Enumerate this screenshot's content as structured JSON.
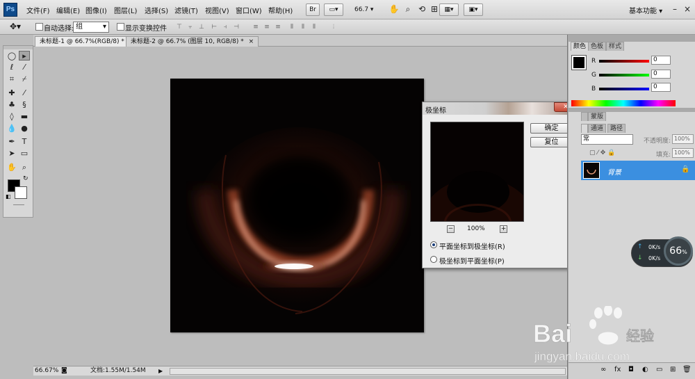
{
  "menubar": {
    "logo": "Ps",
    "menus": [
      "文件(F)",
      "编辑(E)",
      "图像(I)",
      "图层(L)",
      "选择(S)",
      "滤镜(T)",
      "视图(V)",
      "窗口(W)",
      "帮助(H)"
    ],
    "br_button": "Br",
    "zoom_value": "66.7",
    "workspace": "基本功能"
  },
  "options": {
    "auto_select_label": "自动选择:",
    "auto_select_value": "组",
    "show_transform_label": "显示变换控件"
  },
  "tabs": [
    {
      "label": "未标题-1 @ 66.7%(RGB/8) *",
      "close": "×"
    },
    {
      "label": "未标题-2 @ 66.7% (图层 10, RGB/8) *",
      "close": "×"
    }
  ],
  "status": {
    "zoom": "66.67%",
    "doc_info": "文档:1.55M/1.54M"
  },
  "dialog": {
    "title": "极坐标",
    "ok": "确定",
    "reset": "复位",
    "zoom_percent": "100%",
    "zoom_minus": "−",
    "zoom_plus": "+",
    "option1": "平面坐标到极坐标(R)",
    "option2": "极坐标到平面坐标(P)",
    "selected_option": 1
  },
  "color_panel": {
    "tabs": [
      "颜色",
      "色板",
      "样式"
    ],
    "r_label": "R",
    "r_value": "0",
    "g_label": "G",
    "g_value": "0",
    "b_label": "B",
    "b_value": "0"
  },
  "layers_panel": {
    "tabs_top": [
      "",
      "蒙版"
    ],
    "tabs": [
      "",
      "通道",
      "路径"
    ],
    "blend_mode": "常",
    "opacity_label": "不透明度:",
    "opacity_value": "100%",
    "fill_label": "填充:",
    "fill_value": "100%",
    "layer_name": "背景"
  },
  "net_widget": {
    "percent": "66",
    "percent_unit": "%",
    "up": "0K/s",
    "down": "0K/s"
  },
  "watermark": {
    "brand_text": "Bai",
    "brand_cn": "经验",
    "url": "jingyan.baidu.com"
  },
  "colors": {
    "selection_blue": "#3b8fe0",
    "panel_gray": "#d6d6d6",
    "canvas_black": "#050303"
  }
}
